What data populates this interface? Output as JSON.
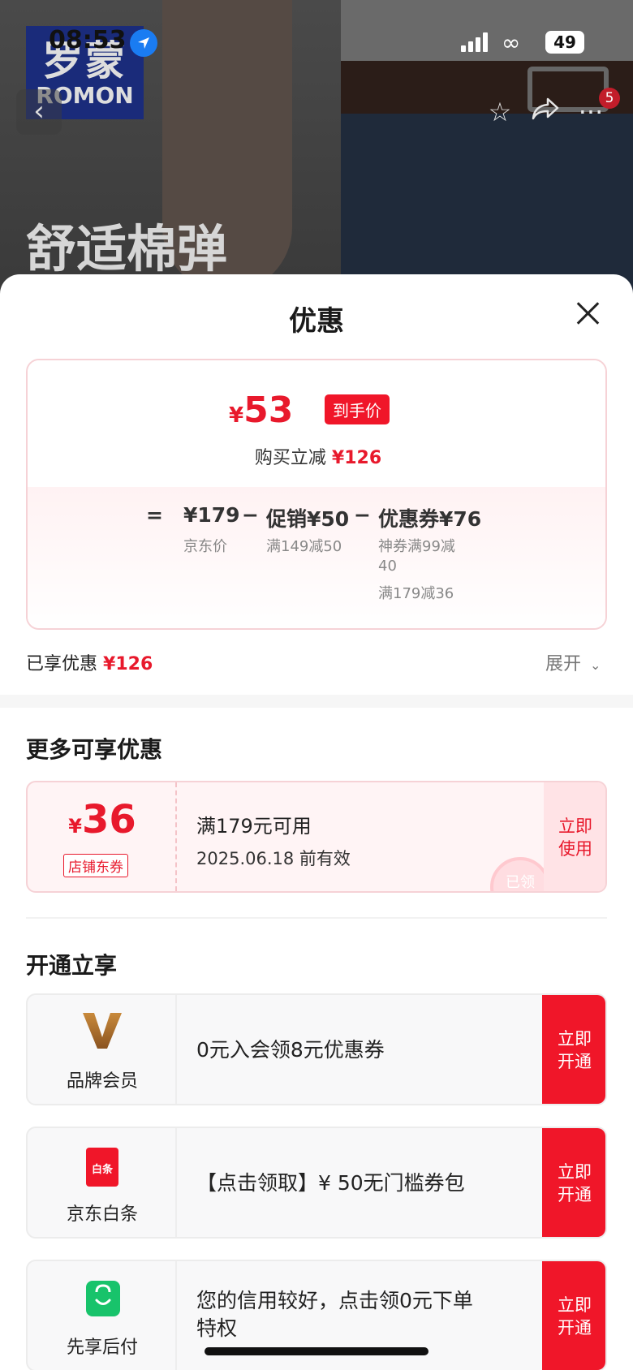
{
  "status_bar": {
    "time": "08:53",
    "battery": "49"
  },
  "background": {
    "brand_cn": "罗蒙",
    "brand_en": "ROMON",
    "slogan": "舒适棉弹",
    "cart_badge": "5"
  },
  "sheet": {
    "title": "优惠",
    "final_price": {
      "yen": "¥",
      "amount": "53",
      "tag": "到手价"
    },
    "reduce": {
      "label": "购买立减",
      "amount": "¥126"
    },
    "calc": {
      "equals": "=",
      "base": {
        "value": "¥179",
        "label": "京东价"
      },
      "minus1": "−",
      "promo": {
        "value": "促销¥50",
        "label": "满149减50"
      },
      "minus2": "−",
      "coupon": {
        "value": "优惠券¥76",
        "label1": "神券满99减",
        "label1b": "40",
        "label2": "满179减36"
      }
    },
    "enjoyed": {
      "label": "已享优惠",
      "amount": "¥126"
    },
    "expand_label": "展开",
    "more_title": "更多可享优惠",
    "coupon": {
      "yen": "¥",
      "amount": "36",
      "type": "店铺东券",
      "condition": "满179元可用",
      "valid": "2025.06.18 前有效",
      "action_l1": "立即",
      "action_l2": "使用",
      "stamp": "已领"
    },
    "open_title": "开通立享",
    "members": [
      {
        "label": "品牌会员",
        "desc": "0元入会领8元优惠券",
        "action_l1": "立即",
        "action_l2": "开通"
      },
      {
        "label": "京东白条",
        "icon_text": "白条",
        "desc": "【点击领取】¥ 50无门槛券包",
        "action_l1": "立即",
        "action_l2": "开通"
      },
      {
        "label": "先享后付",
        "desc_l1": "您的信用较好，点击领0元下单",
        "desc_l2": "特权",
        "action_l1": "立即",
        "action_l2": "开通"
      }
    ]
  },
  "colors": {
    "accent": "#f01629",
    "price_red": "#e8192c"
  }
}
